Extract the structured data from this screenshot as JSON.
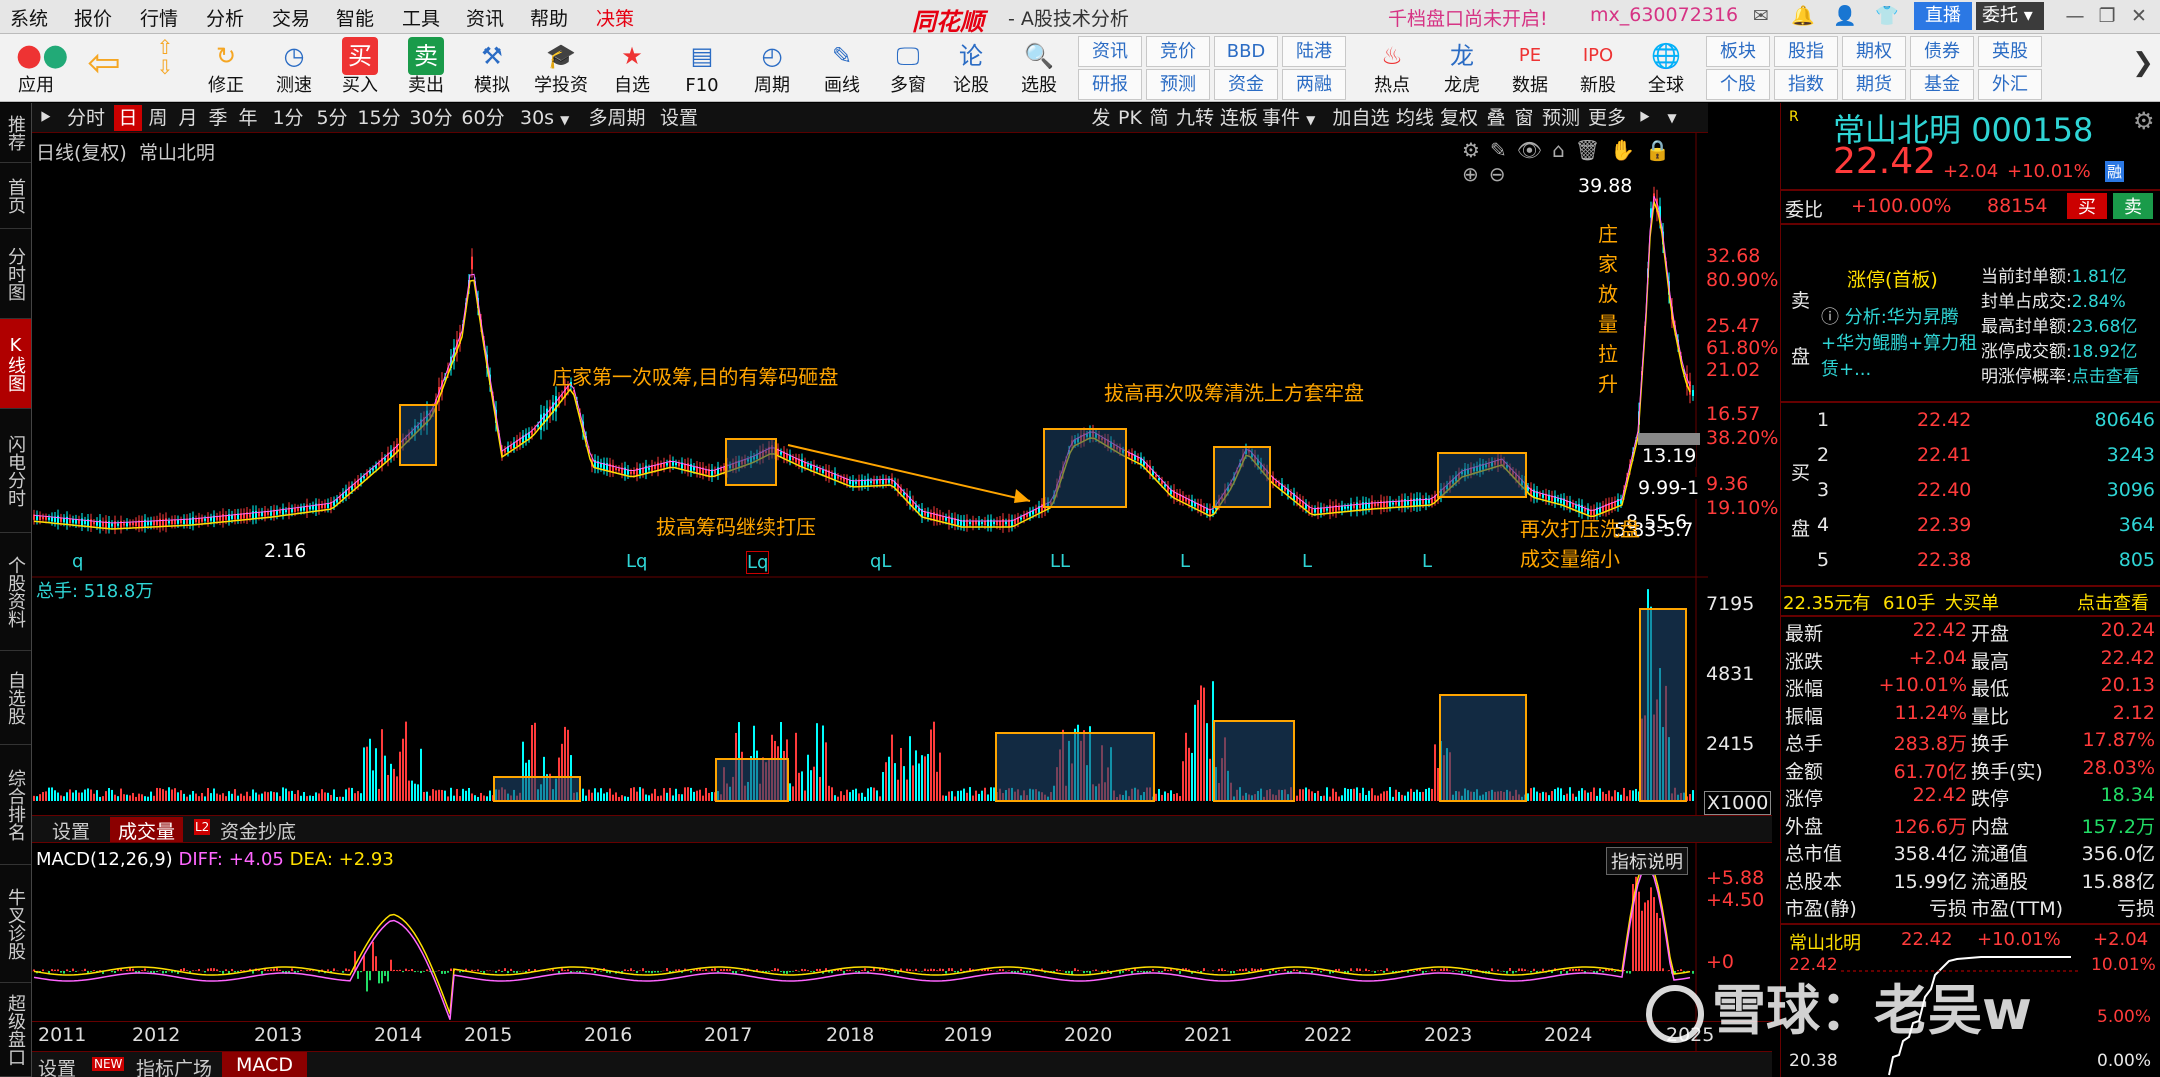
{
  "menu": [
    "系统",
    "报价",
    "行情",
    "分析",
    "交易",
    "智能",
    "工具",
    "资讯",
    "帮助",
    "决策"
  ],
  "brand": "同花顺",
  "subtitle": "- A股技术分析",
  "notice": "千档盘口尚未开启!",
  "account": "mx_630072316",
  "live_btn": "直播",
  "trust_btn": "委托",
  "toolbar": [
    "应用",
    "",
    "修正",
    "测速",
    "买入",
    "卖出",
    "模拟",
    "学投资",
    "自选",
    "F10",
    "周期",
    "画线",
    "多窗",
    "论股",
    "选股"
  ],
  "toolbar_small": [
    [
      "资讯",
      "竞价",
      "BBD",
      "陆港"
    ],
    [
      "研报",
      "预测",
      "资金",
      "两融"
    ]
  ],
  "toolbar2": [
    "热点",
    "龙虎",
    "数据",
    "新股",
    "全球"
  ],
  "toolbar_small2": [
    [
      "板块",
      "股指",
      "期权",
      "债券",
      "英股"
    ],
    [
      "个股",
      "指数",
      "期货",
      "基金",
      "外汇"
    ]
  ],
  "left_tabs": [
    "推荐",
    "首页",
    "分时图",
    "K线图",
    "闪电分时",
    "个股资料",
    "自选股",
    "综合排名",
    "牛叉诊股",
    "超级盘口"
  ],
  "periods": [
    "分时",
    "日",
    "周",
    "月",
    "季",
    "年",
    "1分",
    "5分",
    "15分",
    "30分",
    "60分",
    "30s",
    "多周期",
    "设置"
  ],
  "right_tools": [
    "发",
    "PK",
    "简",
    "九转",
    "连板",
    "事件",
    "加自选",
    "均线",
    "复权",
    "叠",
    "窗",
    "预测",
    "更多"
  ],
  "chart": {
    "title": "日线(复权)",
    "name": "常山北明",
    "prices": {
      "high": "39.88",
      "low": "2.16",
      "p1": "32.68",
      "p2": "25.47",
      "p3": "21.02",
      "p4": "16.57",
      "p5": "9.36",
      "pct1": "80.90%",
      "pct2": "61.80%",
      "pct3": "38.20%",
      "pct4": "19.10%",
      "m1": "13.19",
      "m2": "9.99-1",
      "m3": "8.55-6",
      "m4": "5.83-5.7"
    },
    "annotations": [
      "庄家第一次吸筹,目的有筹码砸盘",
      "拔高筹码继续打压",
      "拔高再次吸筹清洗上方套牢盘",
      "庄家放量拉升",
      "再次打压洗盘",
      "成交量缩小"
    ],
    "vol_label": "总手: 518.8万",
    "vol_ticks": [
      "7195",
      "4831",
      "2415",
      "X1000"
    ],
    "sub_tabs": [
      "设置",
      "成交量",
      "资金抄底"
    ],
    "macd_label": "MACD(12,26,9)",
    "diff": "DIFF: +4.05",
    "dea": "DEA: +2.93",
    "macd_btn": "指标说明",
    "macd_ticks": [
      "+5.88",
      "+4.50",
      "+0"
    ],
    "years": [
      "2011",
      "2012",
      "2013",
      "2014",
      "2015",
      "2016",
      "2017",
      "2018",
      "2019",
      "2020",
      "2021",
      "2022",
      "2023",
      "2024",
      "2025"
    ],
    "bottom_tabs": [
      "设置",
      "指标广场",
      "MACD"
    ],
    "new_badge": "NEW",
    "markers": [
      "q",
      "Lq",
      "Lq",
      "qL",
      "LL",
      "L",
      "L",
      "L"
    ]
  },
  "right": {
    "name": "常山北明",
    "code": "000158",
    "price": "22.42",
    "chg": "+2.04",
    "pct": "+10.01%",
    "tag": "融",
    "webi": "委比",
    "webi_v": "+100.00%",
    "webi_n": "88154",
    "buy": "买",
    "sell": "卖",
    "zt": "涨停(首板)",
    "analysis": "分析:华为昇腾+华为鲲鹏+算力租赁+...",
    "zt_stats": [
      [
        "当前封单额:",
        "1.81亿"
      ],
      [
        "封单占成交:",
        "2.84%"
      ],
      [
        "最高封单额:",
        "23.68亿"
      ],
      [
        "涨停成交额:",
        "18.92亿"
      ],
      [
        "明涨停概率:",
        "点击查看"
      ]
    ],
    "sell_side": "卖盘",
    "buy_side": "买盘",
    "bids": [
      [
        "1",
        "22.42",
        "80646"
      ],
      [
        "2",
        "22.41",
        "3243"
      ],
      [
        "3",
        "22.40",
        "3096"
      ],
      [
        "4",
        "22.39",
        "364"
      ],
      [
        "5",
        "22.38",
        "805"
      ]
    ],
    "strip": [
      "22.35元有",
      "610手",
      "大买单",
      "点击查看"
    ],
    "stats": [
      [
        "最新",
        "22.42",
        "开盘",
        "20.24"
      ],
      [
        "涨跌",
        "+2.04",
        "最高",
        "22.42"
      ],
      [
        "涨幅",
        "+10.01%",
        "最低",
        "20.13"
      ],
      [
        "振幅",
        "11.24%",
        "量比",
        "2.12"
      ],
      [
        "总手",
        "283.8万",
        "换手",
        "17.87%"
      ],
      [
        "金额",
        "61.70亿",
        "换手(实)",
        "28.03%"
      ],
      [
        "涨停",
        "22.42",
        "跌停",
        "18.34"
      ],
      [
        "外盘",
        "126.6万",
        "内盘",
        "157.2万"
      ],
      [
        "总市值",
        "358.4亿",
        "流通值",
        "356.0亿"
      ],
      [
        "总股本",
        "15.99亿",
        "流通股",
        "15.88亿"
      ],
      [
        "市盈(静)",
        "亏损",
        "市盈(TTM)",
        "亏损"
      ]
    ],
    "mini": {
      "name": "常山北明",
      "price": "22.42",
      "pct": "+10.01%",
      "chg": "+2.04",
      "l1": "22.42",
      "r1": "10.01%",
      "r2": "5.00%",
      "l3": "20.38",
      "r3": "0.00%"
    },
    "watermark": "雪球：老吴w"
  },
  "colors": {
    "up": "#ff3b3b",
    "down": "#00ffff",
    "box": "#ffa500",
    "accent": "#cc0000"
  }
}
